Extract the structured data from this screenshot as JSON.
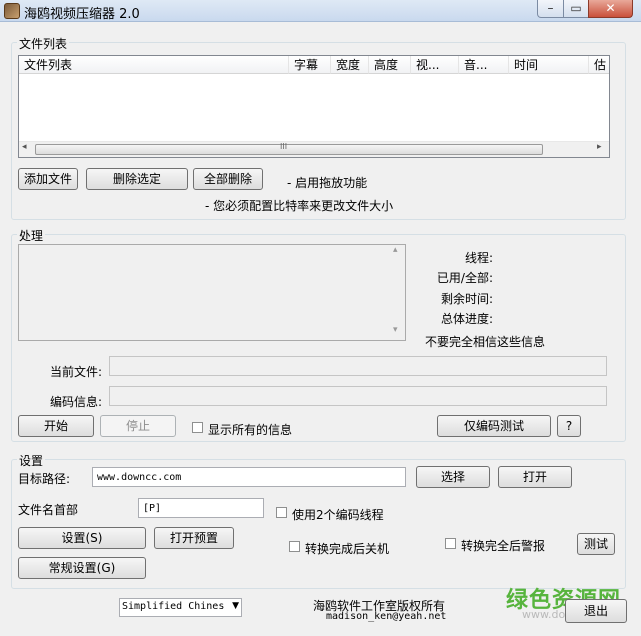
{
  "window": {
    "title": "海鸥视频压缩器 2.0",
    "minimize": "–",
    "maximize": "▭",
    "close": "✕"
  },
  "file_group": {
    "label": "文件列表",
    "columns": [
      "文件列表",
      "字幕",
      "宽度",
      "高度",
      "视...",
      "音...",
      "时间",
      "估"
    ],
    "scroll_left": "◂",
    "scroll_right": "▸",
    "scroll_grip": "III",
    "add_button": "添加文件",
    "delete_selected_button": "删除选定",
    "delete_all_button": "全部删除",
    "drag_hint": "- 启用拖放功能",
    "bitrate_hint": "- 您必须配置比特率来更改文件大小"
  },
  "process_group": {
    "label": "处理",
    "scroll_up": "▴",
    "scroll_down": "▾",
    "threads_label": "线程:",
    "used_total_label": "已用/全部:",
    "remaining_label": "剩余时间:",
    "progress_label": "总体进度:",
    "disclaimer": "不要完全相信这些信息",
    "current_file_label": "当前文件:",
    "encode_info_label": "编码信息:",
    "start_button": "开始",
    "stop_button": "停止",
    "show_all_label": "显示所有的信息",
    "encode_test_button": "仅编码测试",
    "help_button": "?"
  },
  "settings_group": {
    "label": "设置",
    "target_path_label": "目标路径:",
    "target_path_value": "www.downcc.com",
    "select_button": "选择",
    "open_button": "打开",
    "filename_prefix_label": "文件名首部",
    "filename_prefix_value": "[P]",
    "dual_thread_label": "使用2个编码线程",
    "settings_button": "设置(S)",
    "open_preset_button": "打开预置",
    "shutdown_label": "转换完成后关机",
    "alarm_label": "转换完全后警报",
    "test_button": "测试",
    "general_settings_button": "常规设置(G)"
  },
  "footer": {
    "language": "Simplified Chines",
    "copyright": "海鸥软件工作室版权所有",
    "email": "madison_ken@yeah.net",
    "exit_button": "退出",
    "watermark": "绿色资源网",
    "watermark_url": "www.downcc.com"
  }
}
